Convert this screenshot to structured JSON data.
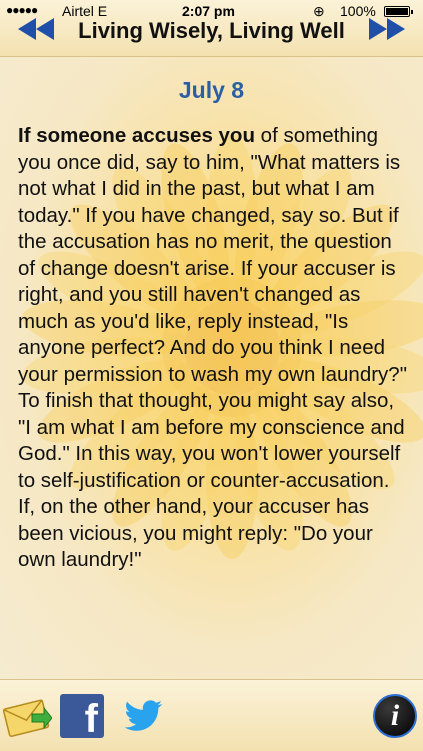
{
  "status_bar": {
    "signal_dots": "●●●●●",
    "carrier": "Airtel  E",
    "time": "2:07 pm",
    "orientation_lock_icon": "⊕",
    "battery_percent": "100%",
    "battery_level": 1.0
  },
  "navbar": {
    "title": "Living Wisely, Living Well",
    "prev_icon": "double-left-arrow-icon",
    "next_icon": "double-right-arrow-icon",
    "arrow_color": "#1f4fa8"
  },
  "entry": {
    "date": "July 8",
    "lead": "If someone accuses you",
    "body": " of something you once did, say to him, \"What matters is not what I did in the past, but what I am today.\" If you have changed, say so. But if the accusation has no merit, the question of change doesn't arise. If your accuser is right, and you still haven't changed as much as you'd like, reply instead, \"Is anyone perfect? And do you think I need your permission to wash my own laundry?\" To finish that thought, you might say also, \"I am what I am before my conscience and God.\" In this way, you won't lower yourself to self-justification or counter-accusation. If, on the other hand, your accuser has been vicious, you might reply: \"Do your own laundry!\""
  },
  "toolbar": {
    "mail_icon": "mail-envelope-icon",
    "facebook_icon": "facebook-icon",
    "facebook_glyph": "f",
    "twitter_icon": "twitter-bird-icon",
    "info_icon": "info-icon",
    "info_glyph": "i"
  }
}
